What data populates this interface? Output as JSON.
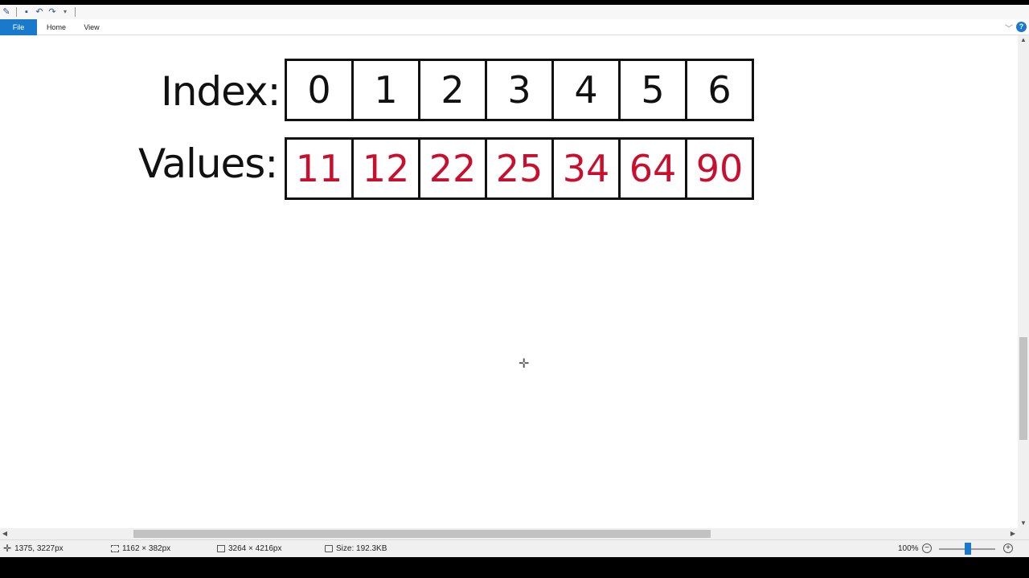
{
  "ribbon": {
    "tabs": [
      "File",
      "Home",
      "View"
    ],
    "collapse_icon": "chevron-down-icon",
    "help_glyph": "?"
  },
  "quick_access": {
    "icons": [
      "paint-app-icon",
      "save-icon",
      "undo-icon",
      "redo-icon",
      "customize-dropdown-icon"
    ]
  },
  "canvas": {
    "index_label": "Index:",
    "values_label": "Values:",
    "indices": [
      "0",
      "1",
      "2",
      "3",
      "4",
      "5",
      "6"
    ],
    "values": [
      "11",
      "12",
      "22",
      "25",
      "34",
      "64",
      "90"
    ],
    "value_color": "#c8102e",
    "cursor_glyph": "✛"
  },
  "status_bar": {
    "cursor_position": "1375, 3227px",
    "selection_size": "1162 × 382px",
    "image_size": "3264 × 4216px",
    "file_size": "Size: 192.3KB",
    "zoom": "100%",
    "zoom_level": 1.0
  }
}
